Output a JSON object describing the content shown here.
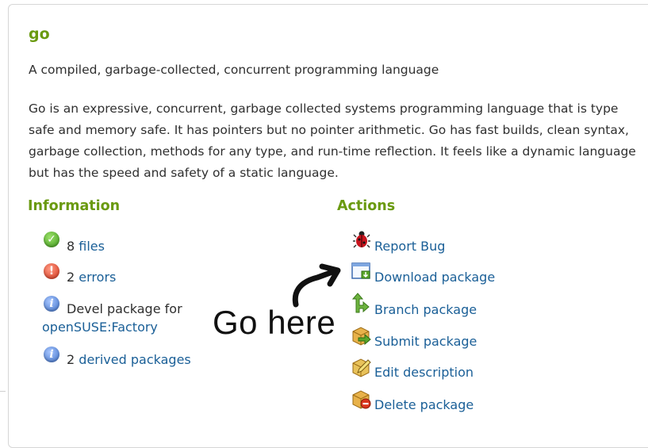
{
  "package": {
    "name": "go",
    "summary": "A compiled, garbage-collected, concurrent programming language",
    "description": "Go is an expressive, concurrent, garbage collected systems programming language that is type safe and memory safe. It has pointers but no pointer arithmetic. Go has fast builds, clean syntax, garbage collection, methods for any type, and run-time reflection. It feels like a dynamic language but has the speed and safety of a static language."
  },
  "information": {
    "heading": "Information",
    "files_count": "8",
    "files_label": "files",
    "errors_count": "2",
    "errors_label": "errors",
    "devel_text": "Devel package for",
    "devel_project": "openSUSE:Factory",
    "derived_count": "2",
    "derived_label": "derived packages"
  },
  "actions": {
    "heading": "Actions",
    "items": [
      {
        "label": "Report Bug",
        "icon": "bug-icon"
      },
      {
        "label": "Download package",
        "icon": "download-window-icon"
      },
      {
        "label": "Branch package",
        "icon": "branch-arrow-icon"
      },
      {
        "label": "Submit package",
        "icon": "package-submit-icon"
      },
      {
        "label": "Edit description",
        "icon": "package-edit-icon"
      },
      {
        "label": "Delete package",
        "icon": "package-delete-icon"
      }
    ]
  },
  "annotation": {
    "text": "Go here"
  },
  "colors": {
    "heading_green": "#6a9a10",
    "link_blue": "#1a5f97"
  }
}
